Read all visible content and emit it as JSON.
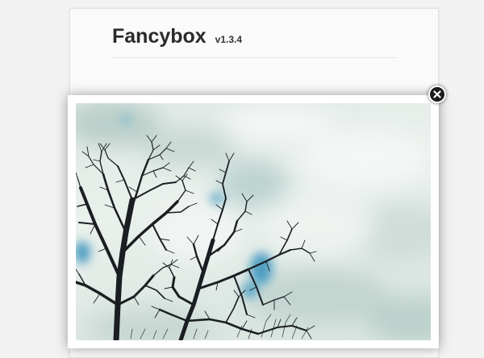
{
  "page": {
    "title": "Fancybox",
    "version": "v1.3.4"
  },
  "lightbox": {
    "image_subject": "bare-tree-branches-against-cloudy-sky",
    "close_icon": "close-icon"
  },
  "colors": {
    "page_background": "#f2f2f2",
    "card_background": "#fafafa",
    "lightbox_frame": "#ffffff",
    "close_button": "#1c1c1c",
    "sky_blue": "#4d9ec2"
  }
}
